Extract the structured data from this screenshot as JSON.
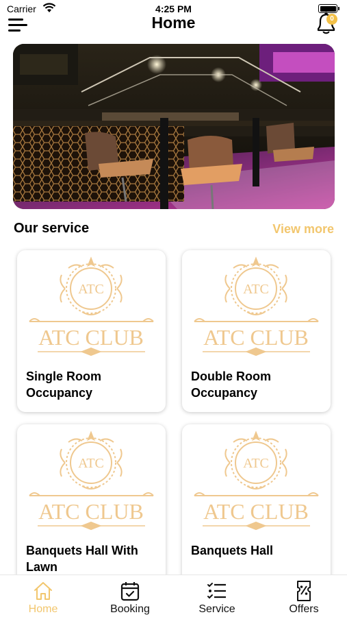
{
  "status_bar": {
    "carrier": "Carrier",
    "time": "4:25 PM"
  },
  "header": {
    "title": "Home",
    "menu_icon": "hamburger-menu-icon",
    "notification_icon": "bell-icon",
    "notification_badge": "0"
  },
  "banner": {
    "description_icon": "club-lounge-photo"
  },
  "services_section": {
    "title": "Our service",
    "view_more_label": "View more",
    "logo_text": "ATC CLUB",
    "logo_monogram": "ATC",
    "items": [
      {
        "label": "Single Room Occupancy"
      },
      {
        "label": "Double Room Occupancy"
      },
      {
        "label": "Banquets Hall With Lawn"
      },
      {
        "label": "Banquets Hall"
      }
    ]
  },
  "tab_bar": {
    "tabs": [
      {
        "label": "Home",
        "icon": "home-icon",
        "active": true
      },
      {
        "label": "Booking",
        "icon": "calendar-icon",
        "active": false
      },
      {
        "label": "Service",
        "icon": "checklist-icon",
        "active": false
      },
      {
        "label": "Offers",
        "icon": "ticket-percent-icon",
        "active": false
      }
    ]
  },
  "colors": {
    "accent": "#f2c66d",
    "logo_gold": "#efc88f",
    "badge": "#f2c047"
  }
}
